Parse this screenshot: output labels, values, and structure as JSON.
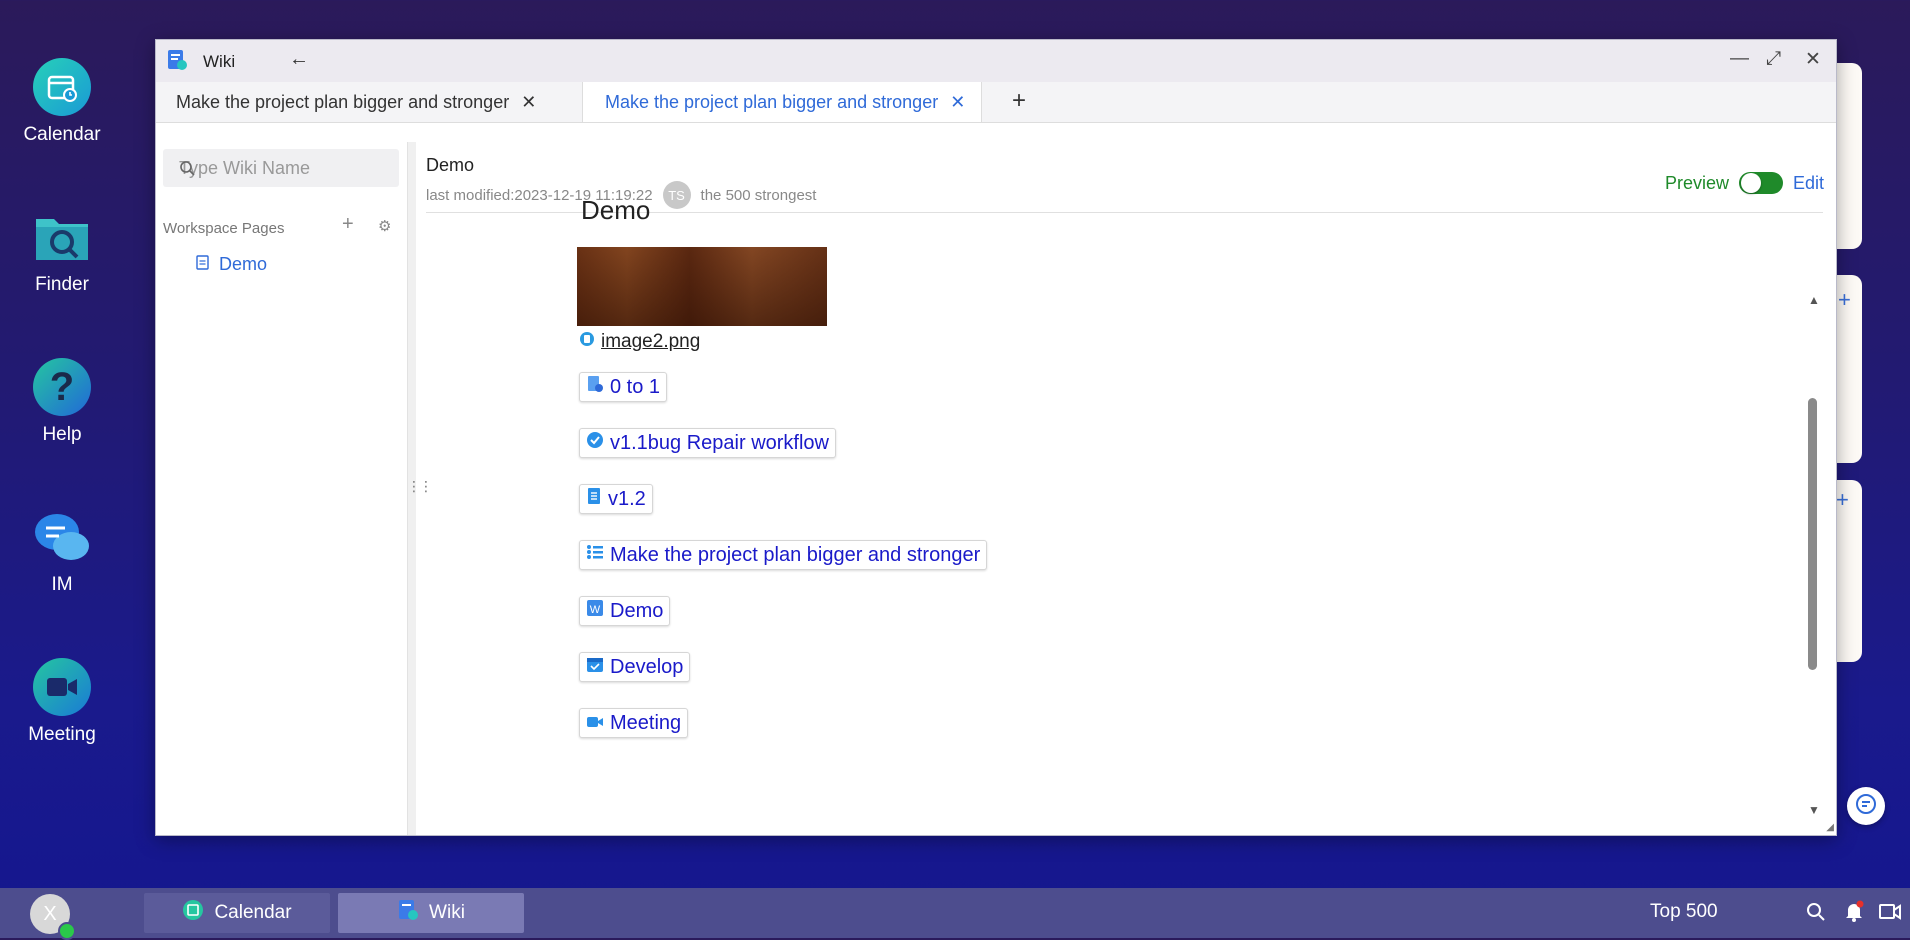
{
  "desktop": {
    "icons": [
      {
        "label": "Calendar"
      },
      {
        "label": "Finder"
      },
      {
        "label": "Help"
      },
      {
        "label": "IM"
      },
      {
        "label": "Meeting"
      }
    ]
  },
  "window": {
    "title": "Wiki",
    "tabs": [
      {
        "label": "Make the project plan bigger and stronger",
        "active": false
      },
      {
        "label": "Make the project plan bigger and stronger",
        "active": true
      }
    ]
  },
  "sidebar": {
    "search_placeholder": "Type Wiki Name",
    "section_label": "Workspace Pages",
    "items": [
      {
        "label": "Demo"
      }
    ]
  },
  "document": {
    "title": "Demo",
    "last_modified": "last modified:2023-12-19 11:19:22",
    "avatar_initials": "TS",
    "author": "the 500 strongest",
    "mode_preview": "Preview",
    "mode_edit": "Edit",
    "heading": "Demo",
    "file_link": "image2.png",
    "chips": [
      {
        "label": "0 to 1",
        "icon": "doc-flow-icon"
      },
      {
        "label": "v1.1bug Repair workflow",
        "icon": "check-circle-icon"
      },
      {
        "label": "v1.2",
        "icon": "sheet-icon"
      },
      {
        "label": "Make the project plan bigger and stronger",
        "icon": "list-icon"
      },
      {
        "label": "Demo",
        "icon": "wiki-icon"
      },
      {
        "label": "Develop",
        "icon": "calendar-icon"
      },
      {
        "label": "Meeting",
        "icon": "video-icon"
      }
    ]
  },
  "taskbar": {
    "user_initial": "X",
    "items": [
      {
        "label": "Calendar"
      },
      {
        "label": "Wiki"
      }
    ],
    "tray_label": "Top 500"
  },
  "colors": {
    "accent": "#2f6ad8",
    "link": "#1a1ac9",
    "preview_green": "#1f8a2a",
    "taskbar": "#4d4d8e"
  }
}
